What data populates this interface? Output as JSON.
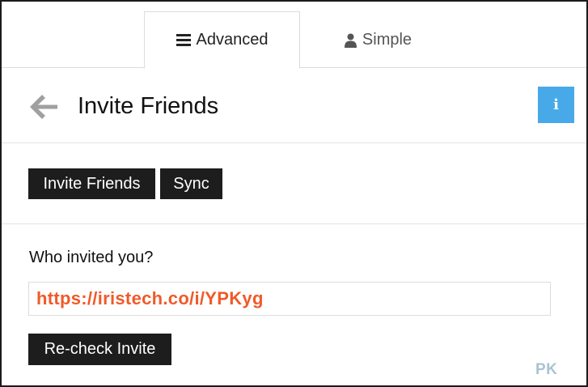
{
  "tabs": {
    "advanced_label": "Advanced",
    "advanced_icon": "list-icon",
    "simple_label": "Simple",
    "simple_icon": "user-icon"
  },
  "header": {
    "back_icon": "arrow-left-icon",
    "title": "Invite Friends",
    "info_icon": "info-icon",
    "info_label": "i"
  },
  "actions": {
    "invite_label": "Invite Friends",
    "sync_label": "Sync"
  },
  "invite": {
    "question": "Who invited you?",
    "url": "https://iristech.co/i/YPKyg",
    "recheck_label": "Re-check Invite"
  },
  "watermark": "PK",
  "colors": {
    "button_bg": "#1d1d1d",
    "info_accent": "#47a9e8",
    "link_orange": "#f05a28",
    "back_arrow": "#a0a0a0"
  }
}
